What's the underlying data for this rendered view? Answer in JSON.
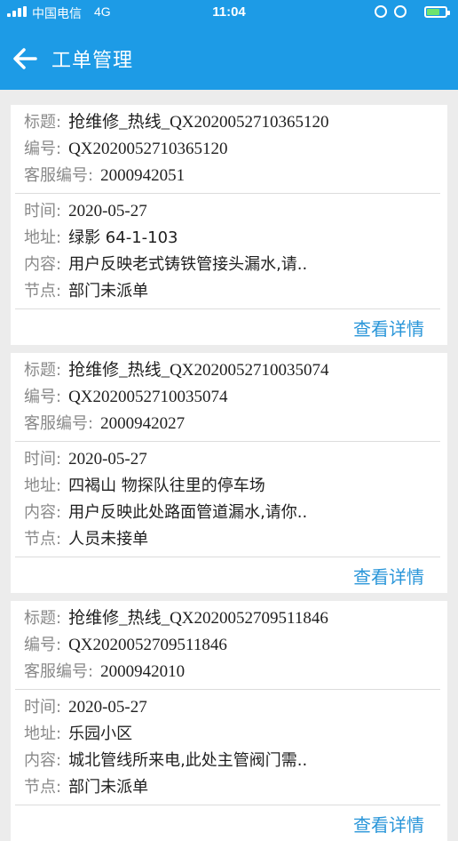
{
  "status_bar": {
    "carrier": "中国电信",
    "network": "4G",
    "time": "11:04"
  },
  "header": {
    "title": "工单管理"
  },
  "tickets": [
    {
      "title_label": "标题:",
      "title_value": "抢维修_热线_QX2020052710365120",
      "number_label": "编号:",
      "number_value": "QX2020052710365120",
      "cs_label": "客服编号:",
      "cs_value": "2000942051",
      "time_label": "时间:",
      "time_value": "2020-05-27",
      "addr_label": "地址:",
      "addr_value": "绿影 64-1-103",
      "content_label": "内容:",
      "content_value": "用户反映老式铸铁管接头漏水,请..",
      "node_label": "节点:",
      "node_value": "部门未派单",
      "detail_label": "查看详情"
    },
    {
      "title_label": "标题:",
      "title_value": "抢维修_热线_QX2020052710035074",
      "number_label": "编号:",
      "number_value": "QX2020052710035074",
      "cs_label": "客服编号:",
      "cs_value": "2000942027",
      "time_label": "时间:",
      "time_value": "2020-05-27",
      "addr_label": "地址:",
      "addr_value": "四褐山 物探队往里的停车场",
      "content_label": "内容:",
      "content_value": "用户反映此处路面管道漏水,请你..",
      "node_label": "节点:",
      "node_value": "人员未接单",
      "detail_label": "查看详情"
    },
    {
      "title_label": "标题:",
      "title_value": "抢维修_热线_QX2020052709511846",
      "number_label": "编号:",
      "number_value": "QX2020052709511846",
      "cs_label": "客服编号:",
      "cs_value": "2000942010",
      "time_label": "时间:",
      "time_value": "2020-05-27",
      "addr_label": "地址:",
      "addr_value": "乐园小区",
      "content_label": "内容:",
      "content_value": "城北管线所来电,此处主管阀门需..",
      "node_label": "节点:",
      "node_value": "部门未派单",
      "detail_label": "查看详情"
    }
  ]
}
